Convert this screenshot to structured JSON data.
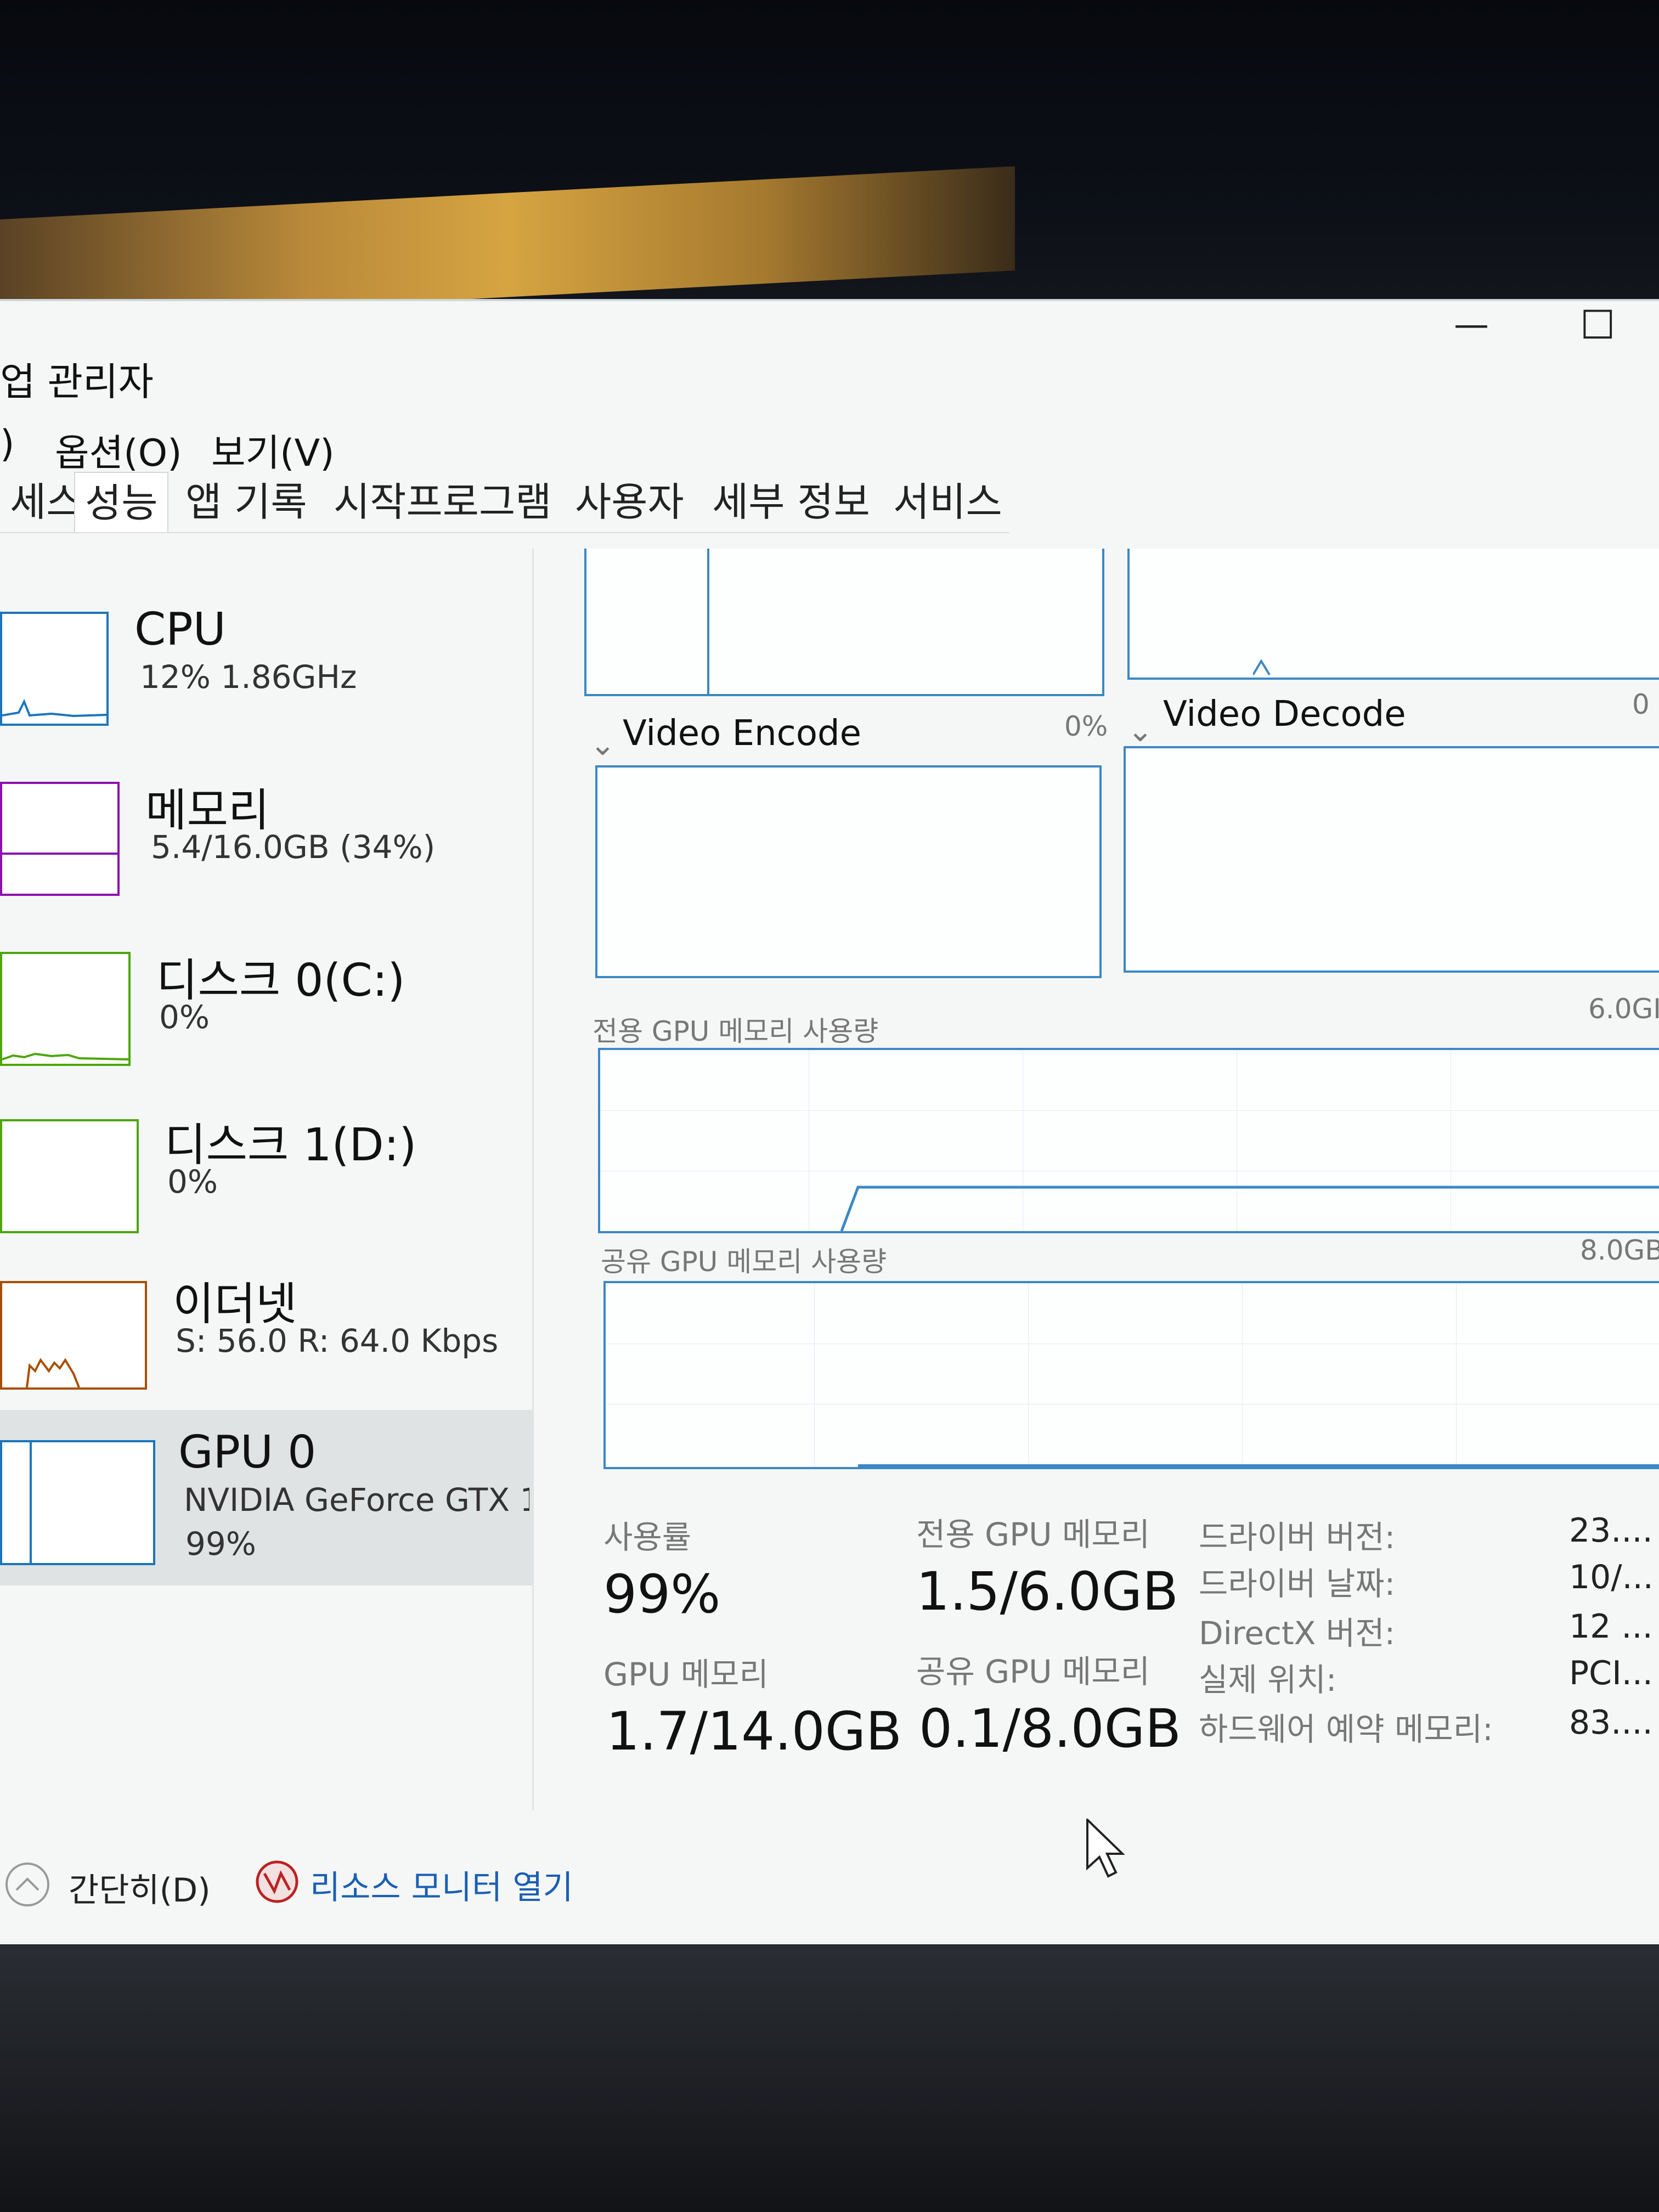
{
  "window": {
    "title": "업 관리자",
    "controls": {
      "minimize": "—",
      "maximize": "☐"
    }
  },
  "menu": [
    {
      "label": ")"
    },
    {
      "label": "옵션(O)"
    },
    {
      "label": "보기(V)"
    }
  ],
  "tabs": [
    {
      "label": "세스"
    },
    {
      "label": "성능",
      "active": true
    },
    {
      "label": "앱 기록"
    },
    {
      "label": "시작프로그램"
    },
    {
      "label": "사용자"
    },
    {
      "label": "세부 정보"
    },
    {
      "label": "서비스"
    }
  ],
  "sidebar": {
    "cpu": {
      "title": "CPU",
      "sub": "12% 1.86GHz"
    },
    "memory": {
      "title": "메모리",
      "sub": "5.4/16.0GB (34%)"
    },
    "disk0": {
      "title": "디스크 0(C:)",
      "sub": "0%"
    },
    "disk1": {
      "title": "디스크 1(D:)",
      "sub": "0%"
    },
    "ethernet": {
      "title": "이더넷",
      "sub": "S: 56.0 R: 64.0 Kbps"
    },
    "gpu": {
      "title": "GPU 0",
      "sub": "NVIDIA GeForce GTX 1(",
      "usage": "99%"
    }
  },
  "graphs": {
    "video_encode": {
      "label": "Video Encode",
      "value": "0%"
    },
    "video_decode": {
      "label": "Video Decode",
      "value": "0"
    },
    "dedicated": {
      "label": "전용 GPU 메모리 사용량",
      "max": "6.0GI"
    },
    "shared": {
      "label": "공유 GPU 메모리 사용량",
      "max": "8.0GB"
    }
  },
  "stats": {
    "usage": {
      "label": "사용률",
      "value": "99%"
    },
    "dedicated": {
      "label": "전용 GPU 메모리",
      "value": "1.5/6.0GB"
    },
    "gpu_memory": {
      "label": "GPU 메모리",
      "value": "1.7/14.0GB"
    },
    "shared": {
      "label": "공유 GPU 메모리",
      "value": "0.1/8.0GB"
    }
  },
  "properties": [
    {
      "label": "드라이버 버전:",
      "value": "23...."
    },
    {
      "label": "드라이버 날짜:",
      "value": "10/..."
    },
    {
      "label": "DirectX 버전:",
      "value": "12 ..."
    },
    {
      "label": "실제 위치:",
      "value": "PCI..."
    },
    {
      "label": "하드웨어 예약 메모리:",
      "value": "83...."
    }
  ],
  "footer": {
    "collapse": "간단히(D)",
    "resmon": "리소스 모니터 열기"
  },
  "colors": {
    "cpu": "#1b75bc",
    "memory": "#8b12ae",
    "disk": "#4da60c",
    "ethernet": "#a74f01",
    "gpu": "#1b75bc",
    "graph_border": "#3c88c4",
    "link": "#1a5fb4"
  },
  "icons": {
    "collapse": "chevron-up-circle-icon",
    "resmon": "resource-monitor-icon",
    "cursor": "mouse-cursor-icon"
  }
}
